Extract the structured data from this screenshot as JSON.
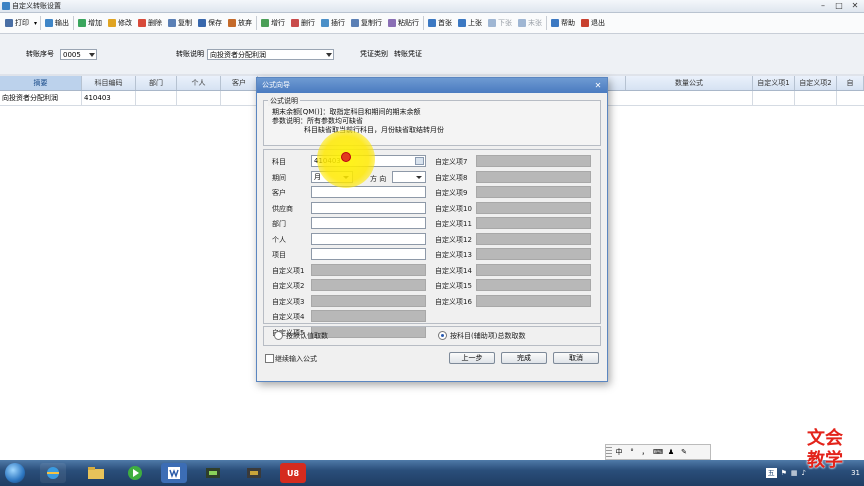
{
  "window": {
    "title": "自定义转账设置"
  },
  "toolbar": {
    "items": [
      {
        "label": "打印",
        "icon": "print-icon",
        "color": "#4a6fa5"
      },
      {
        "label": "输出",
        "icon": "export-icon",
        "color": "#3f86c7"
      },
      {
        "label": "增加",
        "icon": "add-icon",
        "color": "#3aa55d"
      },
      {
        "label": "修改",
        "icon": "edit-icon",
        "color": "#e0a422"
      },
      {
        "label": "删除",
        "icon": "delete-icon",
        "color": "#d84a3a"
      },
      {
        "label": "复制",
        "icon": "copy-icon",
        "color": "#5a7fb5"
      },
      {
        "label": "保存",
        "icon": "save-icon",
        "color": "#3867ac"
      },
      {
        "label": "放弃",
        "icon": "cancel-icon",
        "color": "#c46a2a"
      },
      {
        "label": "增行",
        "icon": "add-row-icon",
        "color": "#4a9e57"
      },
      {
        "label": "删行",
        "icon": "delete-row-icon",
        "color": "#c84a4a"
      },
      {
        "label": "插行",
        "icon": "insert-row-icon",
        "color": "#4a8fc8"
      },
      {
        "label": "复制行",
        "icon": "copy-row-icon",
        "color": "#5a7fb5"
      },
      {
        "label": "粘贴行",
        "icon": "paste-row-icon",
        "color": "#8a6fb5"
      },
      {
        "label": "首张",
        "icon": "first-icon",
        "color": "#3b78c2"
      },
      {
        "label": "上张",
        "icon": "prev-icon",
        "color": "#3b78c2"
      },
      {
        "label": "下张",
        "icon": "next-icon",
        "color": "#9fb6d3",
        "disabled": true
      },
      {
        "label": "末张",
        "icon": "last-icon",
        "color": "#9fb6d3",
        "disabled": true
      },
      {
        "label": "帮助",
        "icon": "help-icon",
        "color": "#3b78c2"
      },
      {
        "label": "退出",
        "icon": "exit-icon",
        "color": "#c8402f"
      }
    ]
  },
  "form": {
    "seq_label": "转账序号",
    "seq_value": "0005",
    "desc_label": "转账说明",
    "desc_value": "向投资者分配利润",
    "voucher_label": "凭证类别",
    "voucher_value": "转账凭证"
  },
  "grid": {
    "headers": [
      "摘要",
      "科目编码",
      "部门",
      "个人",
      "客户",
      "",
      "数量公式",
      "自定义项1",
      "自定义项2",
      "自"
    ],
    "row": {
      "summary": "向投资者分配利润",
      "code": "410403"
    }
  },
  "dialog": {
    "title": "公式向导",
    "help_legend": "公式说明",
    "help_lines": [
      "期末余额[QM()]：取指定科目和期间的期末余额",
      "参数说明：所有参数均可缺省",
      "科目缺省取当前行科目，月份缺省取结转月份"
    ],
    "left_labels": [
      "科目",
      "期间",
      "客户",
      "供应商",
      "部门",
      "个人",
      "项目",
      "自定义项1",
      "自定义项2",
      "自定义项3",
      "自定义项4",
      "自定义项5"
    ],
    "subject_value": "410403",
    "period_value": "月",
    "direction_label": "方 向",
    "right_labels": [
      "自定义项7",
      "自定义项8",
      "自定义项9",
      "自定义项10",
      "自定义项11",
      "自定义项12",
      "自定义项13",
      "自定义项14",
      "自定义项15",
      "自定义项16"
    ],
    "radio_default": "按默认值取数",
    "radio_subject": "按科目(辅助项)总数取数",
    "continue_label": "继续输入公式",
    "btn_prev": "上一步",
    "btn_finish": "完成",
    "btn_cancel": "取消"
  },
  "ime": {
    "items": [
      "中",
      "°",
      "，",
      "⌨",
      "♟",
      "✎"
    ]
  },
  "taskbar": {
    "apps": [
      "ie-icon",
      "folder-icon",
      "media-icon",
      "word-icon",
      "tool-icon",
      "app-icon",
      "u8-icon"
    ],
    "u8_label": "U8",
    "ime_label": "五",
    "time": "31"
  },
  "watermark": {
    "line1": "文会",
    "line2": "教学"
  }
}
